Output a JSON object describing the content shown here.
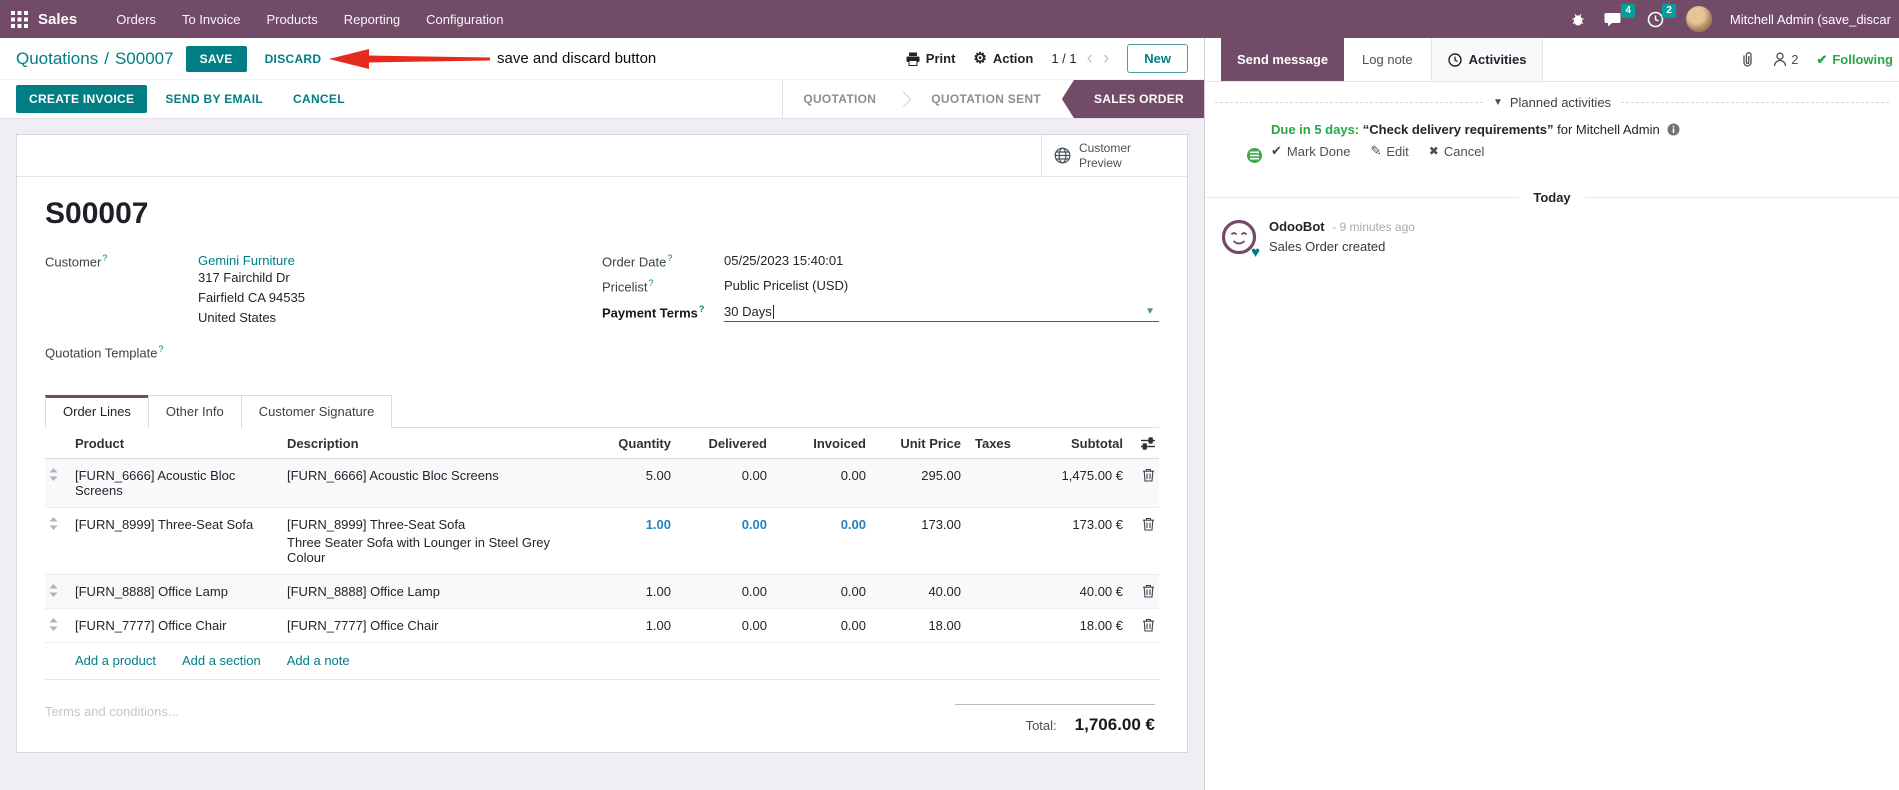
{
  "nav": {
    "app_name": "Sales",
    "menus": [
      "Orders",
      "To Invoice",
      "Products",
      "Reporting",
      "Configuration"
    ],
    "messages_badge": "4",
    "activities_badge": "2",
    "user_name": "Mitchell Admin (save_discar"
  },
  "control_panel": {
    "breadcrumb_parent": "Quotations",
    "separator": "/",
    "record_name": "S00007",
    "save": "SAVE",
    "discard": "DISCARD",
    "print": "Print",
    "action": "Action",
    "pager": "1 / 1",
    "prev": "‹",
    "next": "›",
    "new": "New"
  },
  "annotation": {
    "text": "save and discard button",
    "arrow_color": "#e62b1e"
  },
  "action_bar": {
    "create_invoice": "CREATE INVOICE",
    "send_by_email": "SEND BY EMAIL",
    "cancel": "CANCEL"
  },
  "statusbar": {
    "stages": [
      {
        "label": "QUOTATION"
      },
      {
        "label": "QUOTATION SENT"
      },
      {
        "label": "SALES ORDER"
      }
    ]
  },
  "form": {
    "record_title": "S00007",
    "customer_preview": "Customer Preview",
    "help_mark": "?",
    "fields": {
      "customer_label": "Customer",
      "customer_name": "Gemini Furniture",
      "customer_address": [
        "317 Fairchild Dr",
        "Fairfield CA 94535",
        "United States"
      ],
      "quotation_template_label": "Quotation Template",
      "order_date_label": "Order Date",
      "order_date_value": "05/25/2023 15:40:01",
      "pricelist_label": "Pricelist",
      "pricelist_value": "Public Pricelist (USD)",
      "payment_terms_label": "Payment Terms",
      "payment_terms_value": "30 Days"
    },
    "tabs": [
      "Order Lines",
      "Other Info",
      "Customer Signature"
    ]
  },
  "order_table": {
    "headers": {
      "product": "Product",
      "description": "Description",
      "quantity": "Quantity",
      "delivered": "Delivered",
      "invoiced": "Invoiced",
      "unit_price": "Unit Price",
      "taxes": "Taxes",
      "subtotal": "Subtotal"
    },
    "rows": [
      {
        "product": "[FURN_6666] Acoustic Bloc Screens",
        "description": "[FURN_6666] Acoustic Bloc Screens",
        "description2": "",
        "quantity": "5.00",
        "delivered": "0.00",
        "invoiced": "0.00",
        "unit_price": "295.00",
        "taxes": "",
        "subtotal": "1,475.00 €"
      },
      {
        "product": "[FURN_8999] Three-Seat Sofa",
        "description": "[FURN_8999] Three-Seat Sofa",
        "description2": "Three Seater Sofa with Lounger in Steel Grey Colour",
        "quantity": "1.00",
        "delivered": "0.00",
        "invoiced": "0.00",
        "unit_price": "173.00",
        "taxes": "",
        "subtotal": "173.00 €"
      },
      {
        "product": "[FURN_8888] Office Lamp",
        "description": "[FURN_8888] Office Lamp",
        "description2": "",
        "quantity": "1.00",
        "delivered": "0.00",
        "invoiced": "0.00",
        "unit_price": "40.00",
        "taxes": "",
        "subtotal": "40.00 €"
      },
      {
        "product": "[FURN_7777] Office Chair",
        "description": "[FURN_7777] Office Chair",
        "description2": "",
        "quantity": "1.00",
        "delivered": "0.00",
        "invoiced": "0.00",
        "unit_price": "18.00",
        "taxes": "",
        "subtotal": "18.00 €"
      }
    ],
    "footer_links": [
      "Add a product",
      "Add a section",
      "Add a note"
    ],
    "terms_placeholder": "Terms and conditions...",
    "total_label": "Total:",
    "total_value": "1,706.00 €"
  },
  "chatter": {
    "send_message": "Send message",
    "log_note": "Log note",
    "activities": "Activities",
    "followers_count": "2",
    "following_label": "Following",
    "planned_header": "Planned activities",
    "activity": {
      "due": "Due in 5 days:",
      "summary": "“Check delivery requirements”",
      "for_text": "for Mitchell Admin",
      "mark_done": "Mark Done",
      "edit": "Edit",
      "cancel": "Cancel"
    },
    "today_label": "Today",
    "message": {
      "author": "OdooBot",
      "time": "- 9 minutes ago",
      "body": "Sales Order created"
    }
  },
  "icons": {
    "apps": "grid-3x3",
    "bug": "debug-bug",
    "messages": "chat-bubble",
    "activities_clock": "clock",
    "print": "printer",
    "action": "gear",
    "customer_preview": "globe",
    "drag": "up-down-arrows",
    "optional_columns": "sliders",
    "delete_line": "trash",
    "attachment": "paperclip",
    "followers": "person",
    "following_check": "check",
    "mark_done": "check",
    "edit": "pencil",
    "cancel": "x",
    "info": "info-circle",
    "odoobot_badge": "heart"
  },
  "colors": {
    "navbar": "#714B67",
    "primary_teal": "#017e84",
    "stage_active": "#714B67",
    "badge_teal": "#00A09D",
    "highlight_blue": "#2282bd",
    "success_green": "#28a745",
    "annotation_red": "#e62b1e",
    "page_background": "#f0eef4"
  }
}
